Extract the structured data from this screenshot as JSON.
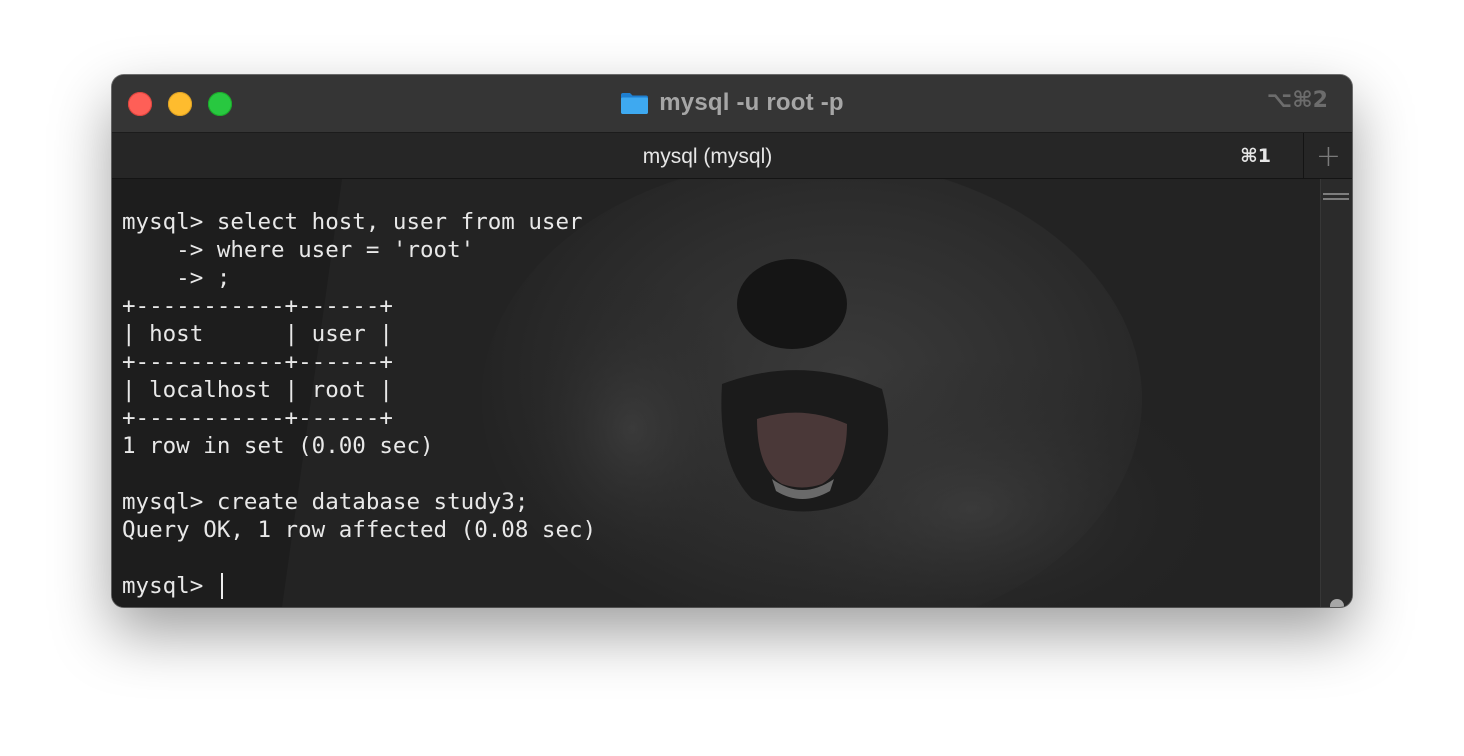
{
  "window": {
    "title": "mysql -u root -p",
    "title_shortcut": "⌥⌘2",
    "folder_icon": "folder-icon"
  },
  "tab": {
    "label": "mysql (mysql)",
    "shortcut": "⌘1",
    "new_tab_label": "+"
  },
  "terminal": {
    "lines": [
      "mysql> select host, user from user",
      "    -> where user = 'root'",
      "    -> ;",
      "+-----------+------+",
      "| host      | user |",
      "+-----------+------+",
      "| localhost | root |",
      "+-----------+------+",
      "1 row in set (0.00 sec)",
      "",
      "mysql> create database study3;",
      "Query OK, 1 row affected (0.08 sec)",
      "",
      "mysql> "
    ],
    "scroll_position": 1.0
  },
  "colors": {
    "close": "#fe5f57",
    "minimize": "#febc2e",
    "zoom": "#28c840",
    "folder": "#3ea9f0",
    "text": "#e8e8e8"
  }
}
